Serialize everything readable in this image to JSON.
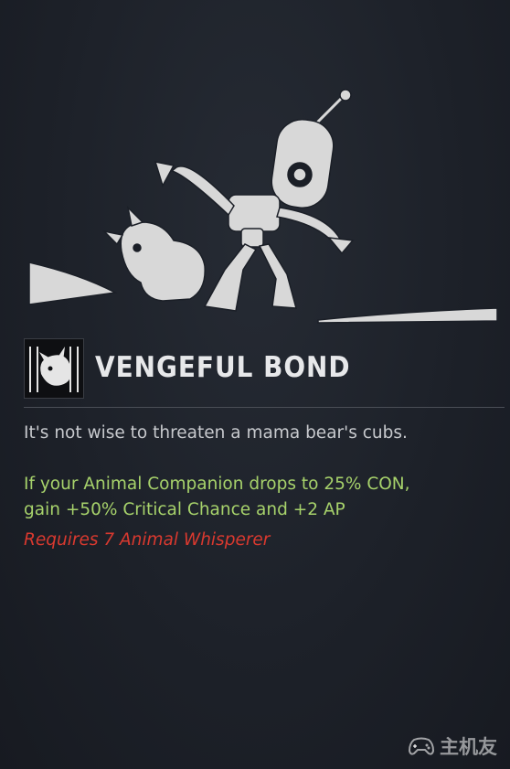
{
  "perk": {
    "title": "VENGEFUL BOND",
    "flavor_text": "It's not wise to threaten a mama bear's cubs.",
    "effect_lines": [
      "If your Animal Companion drops to 25% CON,",
      "gain +50% Critical Chance and +2 AP"
    ],
    "requirement": "Requires 7 Animal Whisperer"
  },
  "watermark": {
    "text": "主机友",
    "icon": "gamepad-icon"
  },
  "colors": {
    "background": "#1b1f27",
    "title": "#e7e8ea",
    "flavor": "#c7c9cd",
    "effect": "#a7d26b",
    "requirement": "#d9392f"
  }
}
